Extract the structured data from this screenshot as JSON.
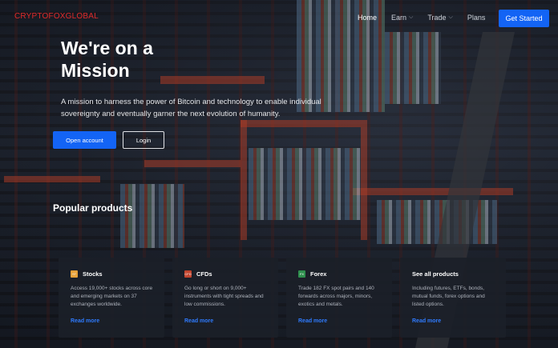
{
  "header": {
    "logo": "CRYPTOFOXGLOBAL",
    "nav": [
      {
        "label": "Home",
        "dropdown": false
      },
      {
        "label": "Earn",
        "dropdown": true
      },
      {
        "label": "Trade",
        "dropdown": true
      },
      {
        "label": "Plans",
        "dropdown": false
      }
    ],
    "cta_label": "Get Started"
  },
  "hero": {
    "title_line1": "We're on a",
    "title_line2": "Mission",
    "description": "A mission to harness the power of Bitcoin and technology to enable individual sovereignty and eventually garner the next evolution of humanity.",
    "open_account_label": "Open account",
    "login_label": "Login"
  },
  "products": {
    "title": "Popular products",
    "cards": [
      {
        "icon": "stocks-icon",
        "icon_text": "ST",
        "icon_color": "#e8a23a",
        "title": "Stocks",
        "description": "Access 19,000+ stocks across core and emerging markets on 37 exchanges worldwide.",
        "link": "Read more"
      },
      {
        "icon": "cfds-icon",
        "icon_text": "CFD",
        "icon_color": "#c2452f",
        "title": "CFDs",
        "description": "Go long or short on 9,000+ instruments with tight spreads and low commissions.",
        "link": "Read more"
      },
      {
        "icon": "forex-icon",
        "icon_text": "FX",
        "icon_color": "#2f8f4e",
        "title": "Forex",
        "description": "Trade 182 FX spot pairs and 140 forwards across majors, minors, exotics and metals.",
        "link": "Read more"
      },
      {
        "icon": "",
        "icon_text": "",
        "icon_color": "",
        "title": "See all products",
        "description": "Including futures, ETFs, bonds, mutual funds, forex options and listed options.",
        "link": "Read more"
      }
    ]
  },
  "colors": {
    "accent": "#1364f5",
    "logo": "#e02b2b",
    "link": "#2f7bff"
  }
}
